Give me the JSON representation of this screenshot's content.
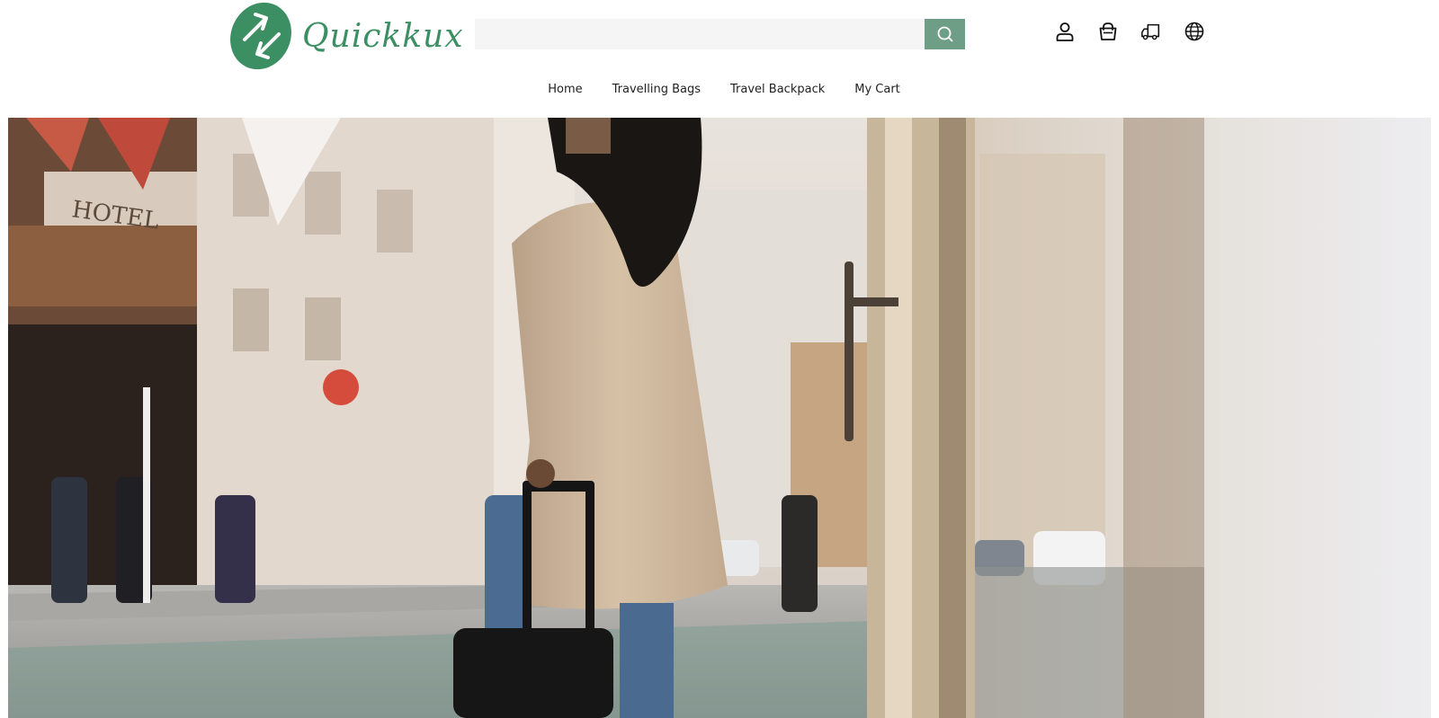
{
  "brand": {
    "name": "Quickkux",
    "accent_color": "#6f9e86",
    "logo_color": "#3c8f63",
    "logo_icon": "arrows-exchange-logo-icon"
  },
  "search": {
    "value": "",
    "placeholder": "",
    "button_icon": "search-icon"
  },
  "header_icons": [
    "user-icon",
    "shopping-bag-icon",
    "delivery-truck-icon",
    "globe-icon"
  ],
  "nav": {
    "items": [
      {
        "label": "Home"
      },
      {
        "label": "Travelling Bags"
      },
      {
        "label": "Travel Backpack"
      },
      {
        "label": "My Cart"
      }
    ]
  },
  "hero": {
    "image_description": "",
    "sign_text": "HOTEL"
  }
}
